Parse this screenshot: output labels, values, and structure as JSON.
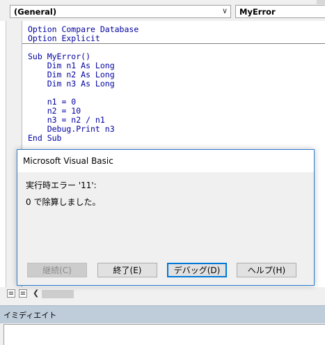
{
  "toolbar": {
    "object_combo": "(General)",
    "procedure_combo": "MyError"
  },
  "code": {
    "declarations": [
      "Option Compare Database",
      "Option Explicit"
    ],
    "procedure": [
      "Sub MyError()",
      "    Dim n1 As Long",
      "    Dim n2 As Long",
      "    Dim n3 As Long",
      "",
      "    n1 = 0",
      "    n2 = 10",
      "    n3 = n2 / n1",
      "    Debug.Print n3",
      "End Sub"
    ]
  },
  "dialog": {
    "title": "Microsoft Visual Basic",
    "error_line": "実行時エラー '11':",
    "message": "0 で除算しました。",
    "buttons": {
      "continue": "継続(C)",
      "end": "終了(E)",
      "debug": "デバッグ(D)",
      "help": "ヘルプ(H)"
    }
  },
  "immediate": {
    "title": "イミディエイト"
  },
  "icons": {
    "dropdown": "chevron-down-icon",
    "procedure_view": "procedure-view-icon",
    "module_view": "full-module-view-icon",
    "scroll_left": "scroll-left-icon"
  }
}
